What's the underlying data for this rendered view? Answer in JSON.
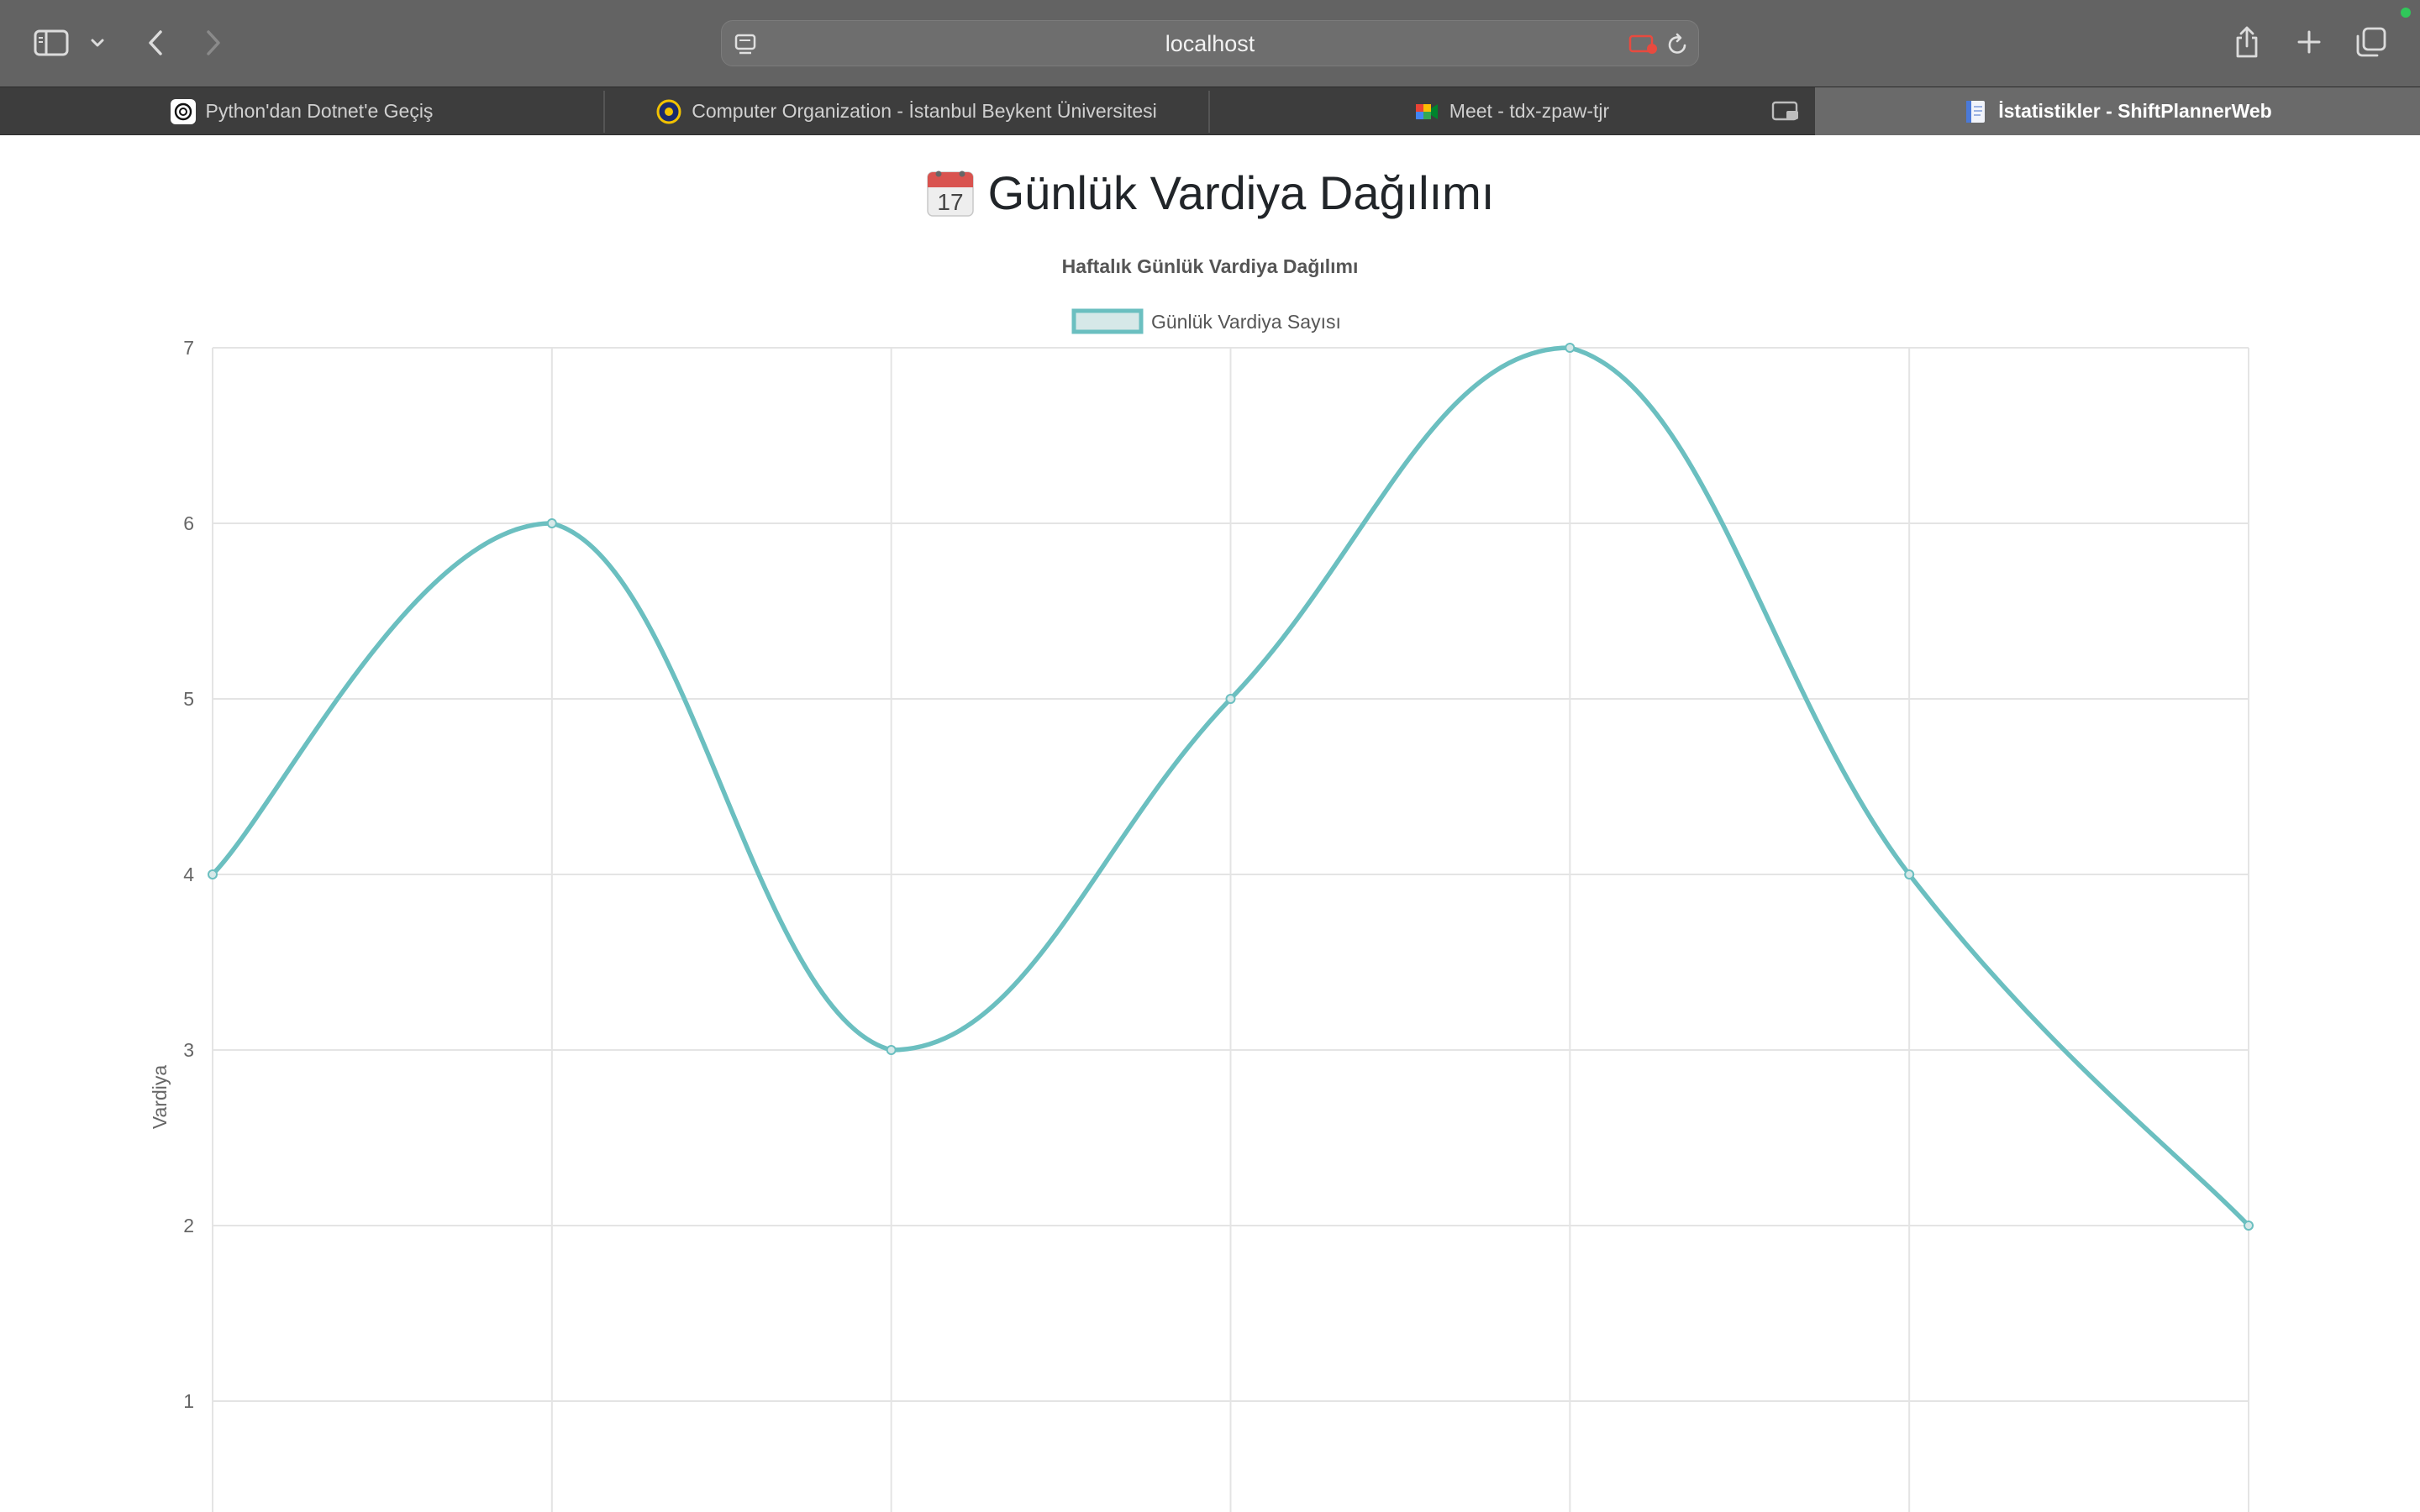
{
  "browser": {
    "url": "localhost",
    "tabs": [
      {
        "label": "Python'dan Dotnet'e Geçiş",
        "icon": "openai-icon",
        "active": false
      },
      {
        "label": "Computer Organization - İstanbul Beykent Üniversitesi",
        "icon": "moodle-icon",
        "active": false
      },
      {
        "label": "Meet - tdx-zpaw-tjr",
        "icon": "meet-icon",
        "active": false
      },
      {
        "label": "İstatistikler - ShiftPlannerWeb",
        "icon": "page-icon",
        "active": true
      }
    ]
  },
  "page": {
    "title_emoji": "calendar-icon",
    "title": "Günlük Vardiya Dağılımı"
  },
  "chart_data": {
    "type": "line",
    "title": "Haftalık Günlük Vardiya Dağılımı",
    "ylabel": "Vardiya",
    "xlabel": "",
    "ylim": [
      0,
      7
    ],
    "yticks": [
      1,
      2,
      3,
      4,
      5,
      6,
      7
    ],
    "grid": true,
    "legend_position": "top",
    "series": [
      {
        "name": "Günlük Vardiya Sayısı",
        "values": [
          4,
          6,
          3,
          5,
          7,
          4,
          2
        ],
        "color": "#6bbfc0",
        "fill": "#d6e8e8"
      }
    ]
  }
}
